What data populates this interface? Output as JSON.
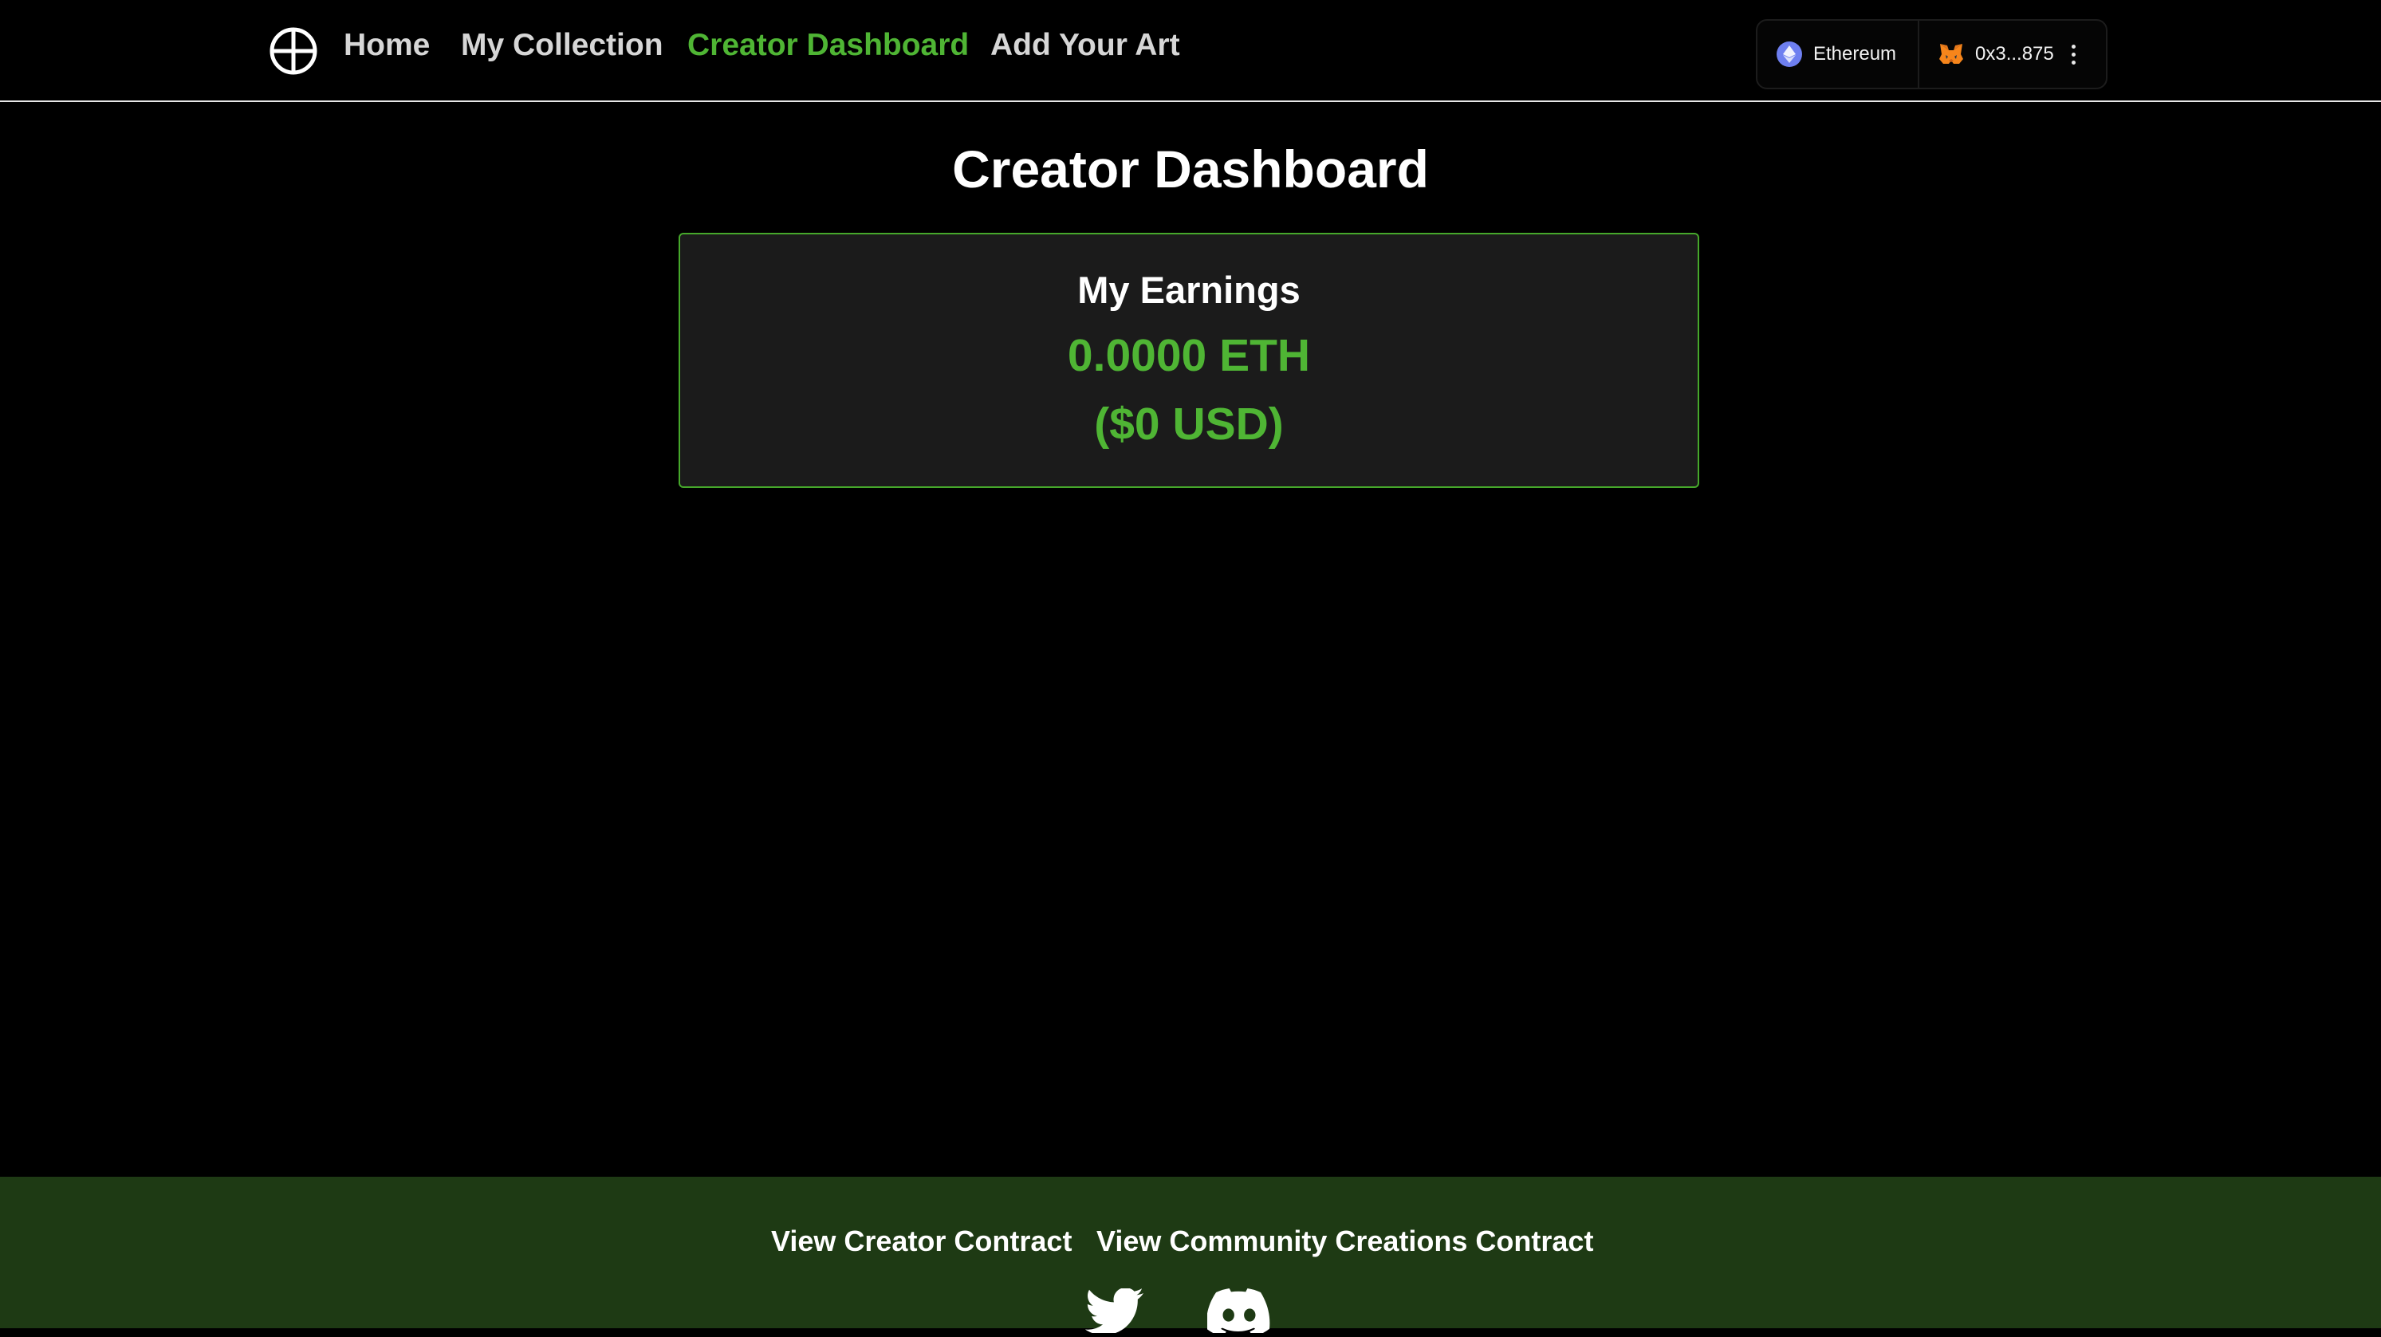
{
  "nav": {
    "links": [
      "Home",
      "My Collection",
      "Creator Dashboard",
      "Add Your Art"
    ],
    "active": "Creator Dashboard"
  },
  "wallet": {
    "network": "Ethereum",
    "account": "0x3...875"
  },
  "main": {
    "title": "Creator Dashboard",
    "earnings_label": "My Earnings",
    "earnings_eth": "0.0000 ETH",
    "earnings_usd": "($0 USD)"
  },
  "footer": {
    "creator_contract": "View Creator Contract",
    "community_contract": "View Community Creations Contract"
  },
  "icons": {
    "logo": "circle-plus-icon",
    "network": "ethereum-icon",
    "account": "metamask-fox-icon",
    "menu": "more-vertical-icon",
    "social": [
      "twitter-icon",
      "discord-icon"
    ]
  },
  "colors": {
    "accent": "#4fb534",
    "footer_bg": "#1e3a14",
    "card_bg": "#1b1b1b"
  }
}
